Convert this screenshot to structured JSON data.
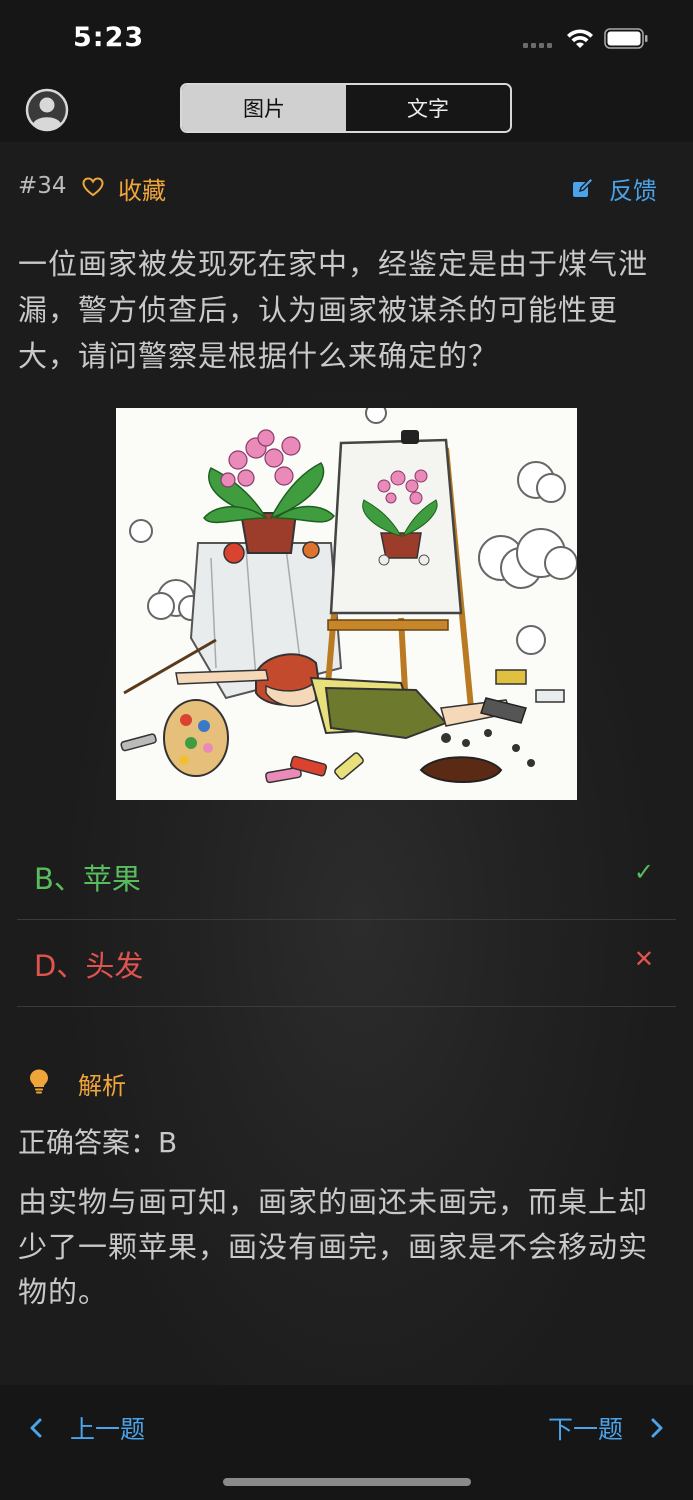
{
  "status": {
    "time": "5:23"
  },
  "tabs": [
    {
      "label": "图片",
      "active": true
    },
    {
      "label": "文字",
      "active": false
    }
  ],
  "question": {
    "number": "#34",
    "favorite_label": "收藏",
    "feedback_label": "反馈",
    "text": "一位画家被发现死在家中，经鉴定是由于煤气泄漏，警方侦查后，认为画家被谋杀的可能性更大，请问警察是根据什么来确定的？"
  },
  "options": [
    {
      "label": "B、苹果",
      "status": "correct",
      "mark": "✓"
    },
    {
      "label": "D、头发",
      "status": "wrong",
      "mark": "✕"
    }
  ],
  "analysis": {
    "title": "解析",
    "answer": "正确答案：B",
    "text": "由实物与画可知，画家的画还未画完，而桌上却少了一颗苹果，画没有画完，画家是不会移动实物的。"
  },
  "footer": {
    "prev_label": "上一题",
    "next_label": "下一题"
  },
  "colors": {
    "accent_blue": "#4ba3e9",
    "accent_orange": "#f0a53a",
    "correct": "#57bd5e",
    "wrong": "#e0534f"
  }
}
